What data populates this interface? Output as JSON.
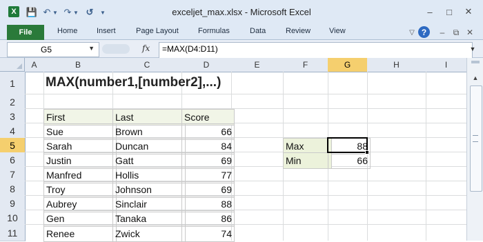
{
  "titlebar": {
    "title": "exceljet_max.xlsx - Microsoft Excel",
    "icons": [
      "excel-logo",
      "save-icon",
      "undo-icon",
      "redo-icon",
      "refresh-icon"
    ],
    "window_controls": [
      "minimize",
      "restore",
      "close"
    ]
  },
  "ribbon": {
    "file_label": "File",
    "tabs": [
      "Home",
      "Insert",
      "Page Layout",
      "Formulas",
      "Data",
      "Review",
      "View"
    ],
    "accent": "#2a7a3a"
  },
  "formula_bar": {
    "name_box": "G5",
    "fx": "fx",
    "formula": "=MAX(D4:D11)"
  },
  "grid": {
    "columns": [
      "A",
      "B",
      "C",
      "D",
      "E",
      "F",
      "G",
      "H",
      "I"
    ],
    "rows": [
      "1",
      "2",
      "3",
      "4",
      "5",
      "6",
      "7",
      "8",
      "9",
      "10",
      "11"
    ],
    "selected_column": "G",
    "selected_row": "5"
  },
  "sheet": {
    "title": "MAX(number1,[number2],...)",
    "headers": [
      "First",
      "Last",
      "Score"
    ],
    "rows": [
      {
        "first": "Sue",
        "last": "Brown",
        "score": "66"
      },
      {
        "first": "Sarah",
        "last": "Duncan",
        "score": "84"
      },
      {
        "first": "Justin",
        "last": "Gatt",
        "score": "69"
      },
      {
        "first": "Manfred",
        "last": "Hollis",
        "score": "77"
      },
      {
        "first": "Troy",
        "last": "Johnson",
        "score": "69"
      },
      {
        "first": "Aubrey",
        "last": "Sinclair",
        "score": "88"
      },
      {
        "first": "Gen",
        "last": "Tanaka",
        "score": "86"
      },
      {
        "first": "Renee",
        "last": "Zwick",
        "score": "74"
      }
    ],
    "summary": [
      {
        "label": "Max",
        "value": "88"
      },
      {
        "label": "Min",
        "value": "66"
      }
    ]
  }
}
